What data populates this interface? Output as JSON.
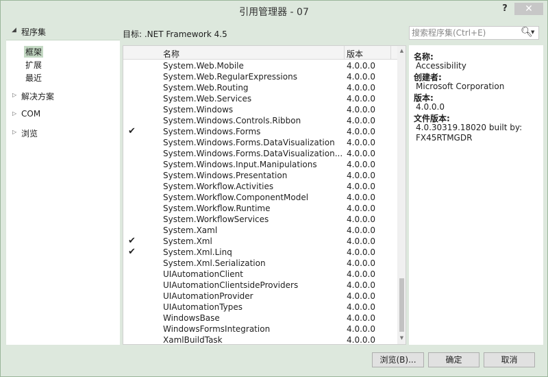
{
  "window": {
    "title": "引用管理器 - 07",
    "help_label": "?",
    "close_label": "✕"
  },
  "left_pane": {
    "assemblies_label": "程序集",
    "assemblies_sub": [
      "框架",
      "扩展",
      "最近"
    ],
    "nodes": [
      "解决方案",
      "COM",
      "浏览"
    ]
  },
  "target_label": "目标: .NET Framework 4.5",
  "search": {
    "placeholder": "搜索程序集(Ctrl+E)"
  },
  "list": {
    "col_name": "名称",
    "col_version": "版本",
    "rows": [
      {
        "name": "System.Web.Mobile",
        "version": "4.0.0.0",
        "checked": false
      },
      {
        "name": "System.Web.RegularExpressions",
        "version": "4.0.0.0",
        "checked": false
      },
      {
        "name": "System.Web.Routing",
        "version": "4.0.0.0",
        "checked": false
      },
      {
        "name": "System.Web.Services",
        "version": "4.0.0.0",
        "checked": false
      },
      {
        "name": "System.Windows",
        "version": "4.0.0.0",
        "checked": false
      },
      {
        "name": "System.Windows.Controls.Ribbon",
        "version": "4.0.0.0",
        "checked": false
      },
      {
        "name": "System.Windows.Forms",
        "version": "4.0.0.0",
        "checked": true
      },
      {
        "name": "System.Windows.Forms.DataVisualization",
        "version": "4.0.0.0",
        "checked": false
      },
      {
        "name": "System.Windows.Forms.DataVisualization....",
        "version": "4.0.0.0",
        "checked": false
      },
      {
        "name": "System.Windows.Input.Manipulations",
        "version": "4.0.0.0",
        "checked": false
      },
      {
        "name": "System.Windows.Presentation",
        "version": "4.0.0.0",
        "checked": false
      },
      {
        "name": "System.Workflow.Activities",
        "version": "4.0.0.0",
        "checked": false
      },
      {
        "name": "System.Workflow.ComponentModel",
        "version": "4.0.0.0",
        "checked": false
      },
      {
        "name": "System.Workflow.Runtime",
        "version": "4.0.0.0",
        "checked": false
      },
      {
        "name": "System.WorkflowServices",
        "version": "4.0.0.0",
        "checked": false
      },
      {
        "name": "System.Xaml",
        "version": "4.0.0.0",
        "checked": false
      },
      {
        "name": "System.Xml",
        "version": "4.0.0.0",
        "checked": true
      },
      {
        "name": "System.Xml.Linq",
        "version": "4.0.0.0",
        "checked": true
      },
      {
        "name": "System.Xml.Serialization",
        "version": "4.0.0.0",
        "checked": false
      },
      {
        "name": "UIAutomationClient",
        "version": "4.0.0.0",
        "checked": false
      },
      {
        "name": "UIAutomationClientsideProviders",
        "version": "4.0.0.0",
        "checked": false
      },
      {
        "name": "UIAutomationProvider",
        "version": "4.0.0.0",
        "checked": false
      },
      {
        "name": "UIAutomationTypes",
        "version": "4.0.0.0",
        "checked": false
      },
      {
        "name": "WindowsBase",
        "version": "4.0.0.0",
        "checked": false
      },
      {
        "name": "WindowsFormsIntegration",
        "version": "4.0.0.0",
        "checked": false
      },
      {
        "name": "XamlBuildTask",
        "version": "4.0.0.0",
        "checked": false
      }
    ]
  },
  "details": {
    "name_label": "名称:",
    "name_value": "Accessibility",
    "creator_label": "创建者:",
    "creator_value": "Microsoft Corporation",
    "version_label": "版本:",
    "version_value": "4.0.0.0",
    "file_version_label": "文件版本:",
    "file_version_value_1": "4.0.30319.18020 built by:",
    "file_version_value_2": "FX45RTMGDR"
  },
  "buttons": {
    "browse": "浏览(B)...",
    "ok": "确定",
    "cancel": "取消"
  }
}
